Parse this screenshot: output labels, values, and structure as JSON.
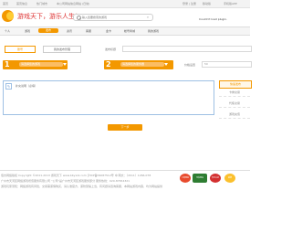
{
  "topbar": {
    "links": [
      "首页",
      "首页信息",
      "热门城市",
      "本公司网站信息网站 (日常)"
    ],
    "right_links": [
      "登录 | 注册",
      "移动版",
      "手机版APP"
    ]
  },
  "logo": {
    "text": "游戏天下，游乐人生！"
  },
  "search": {
    "placeholder": "输入您要搜索的游戏",
    "button": "⌕"
  },
  "error_msg": "Couldn't load plugin.",
  "nav": {
    "items": [
      "个人",
      "游戏",
      "发布",
      "资讯",
      "客服",
      "金卡",
      "帐号商城",
      "我的游戏"
    ],
    "active_index": 2
  },
  "form": {
    "type_buttons": [
      "账号",
      "我的发布管理"
    ],
    "selected_type": 0,
    "title_label": "发布标题",
    "title_value": "",
    "step1_num": "1",
    "step1_select": "请选择您的游戏",
    "step2_num": "2",
    "step2_select": "请选择您的服务器",
    "price_label": "价格设置",
    "price_value": "50",
    "desc_placeholder": "补充说明（必填）",
    "submit_label": "下一步"
  },
  "sidebar": {
    "items": [
      "快速发布",
      "卡券交易",
      "代练交易",
      "游戏充值"
    ]
  },
  "footer": {
    "line1": "佰杰网络版权 Copyright ©2011-2013 游戏天下 www.bbyxzz.com 沪ICP备09087512号  中 网文：（2011）1266-078",
    "line2": "广州市天河区网络游戏增值服务有限公司 “公司”是广州市天河区游戏服务部分  服务热线：020-87654321",
    "line3": "游戏玩家须知：网络游戏有风险，交易需谨慎购买，请认准官方，谨防受骗上当，有问题请咨询客服，本网站游戏内容，均为网站提供",
    "badges": [
      "工商网监",
      "可信网站",
      "安全认证",
      "盾牌"
    ]
  }
}
